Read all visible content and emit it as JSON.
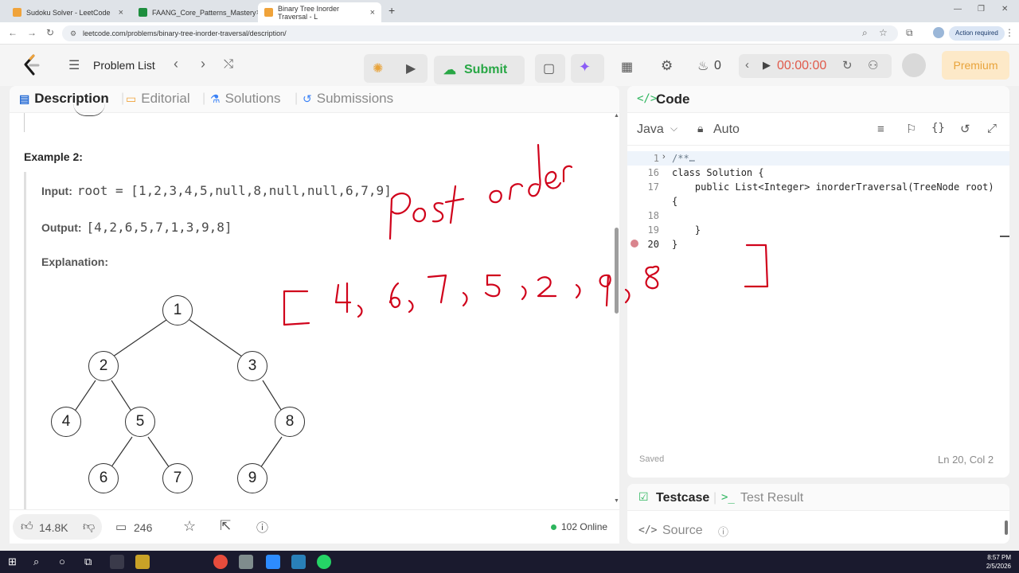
{
  "browser": {
    "tabs": [
      {
        "title": "Sudoku Solver - LeetCode",
        "color": "#f0a33a"
      },
      {
        "title": "FAANG_Core_Patterns_Mastery",
        "color": "#1e8e3e"
      },
      {
        "title": "Binary Tree Inorder Traversal - L",
        "color": "#f0a33a"
      }
    ],
    "url": "leetcode.com/problems/binary-tree-inorder-traversal/description/",
    "action_required": "Action required"
  },
  "header": {
    "problem_list": "Problem List",
    "submit": "Submit",
    "streak": "0",
    "timer": "00:00:00",
    "premium": "Premium"
  },
  "left": {
    "tabs": [
      "Description",
      "Editorial",
      "Solutions",
      "Submissions"
    ],
    "example_title": "Example 2:",
    "input_label": "Input:",
    "input_value": "root = [1,2,3,4,5,null,8,null,null,6,7,9]",
    "output_label": "Output:",
    "output_value": "[4,2,6,5,7,1,3,9,8]",
    "explanation_label": "Explanation:",
    "tree_nodes": [
      "1",
      "2",
      "3",
      "4",
      "5",
      "8",
      "6",
      "7",
      "9"
    ],
    "footer": {
      "likes": "14.8K",
      "comments": "246",
      "online": "102 Online"
    }
  },
  "annotation": {
    "handwritten_title": "Post order",
    "handwritten_list": "[ 4, 6, 7, 5, 2, 9, 8 ]"
  },
  "right": {
    "title": "Code",
    "language": "Java",
    "mode": "Auto",
    "lines": [
      {
        "no": "1",
        "text": "/**…"
      },
      {
        "no": "16",
        "text": "class Solution {"
      },
      {
        "no": "17",
        "text": "    public List<Integer> inorderTraversal(TreeNode root)"
      },
      {
        "no": "",
        "text": "{"
      },
      {
        "no": "18",
        "text": ""
      },
      {
        "no": "19",
        "text": "    }"
      },
      {
        "no": "20",
        "text": "}"
      }
    ],
    "saved": "Saved",
    "cursor": "Ln 20, Col 2"
  },
  "test": {
    "tabs": [
      "Testcase",
      "Test Result"
    ],
    "source": "Source"
  },
  "taskbar": {
    "time": "8:57 PM",
    "date": "2/5/2026"
  }
}
